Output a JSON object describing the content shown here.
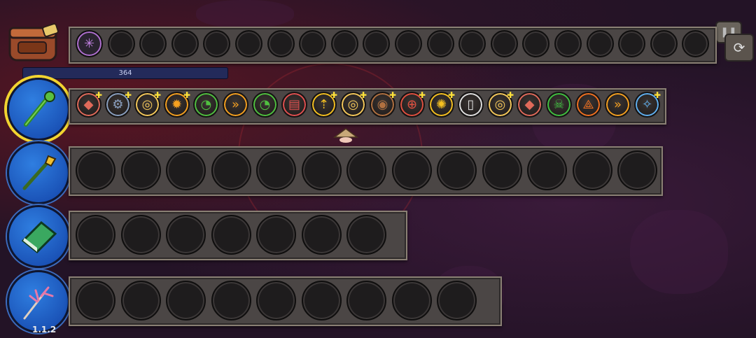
{
  "version": "1.1.2",
  "hp_value": "364",
  "icons": {
    "bag": "backpack-icon",
    "settings": "refresh-icon",
    "pause": "pause-icon"
  },
  "colors": {
    "accent_select": "#f2d430",
    "portrait_blue": "#1e5fc8",
    "bar_gray": "#4b4645"
  },
  "inventory": {
    "total_slots": 20,
    "filled": [
      {
        "icon": "spiderweb-icon"
      }
    ]
  },
  "weapons": [
    {
      "icon": "green-vine-staff-icon",
      "selected": true,
      "upgrades": [
        {
          "icon": "crystal-icon",
          "color": "#e06a5a",
          "plus": true
        },
        {
          "icon": "gear-icon",
          "color": "#8aa0c0",
          "plus": true
        },
        {
          "icon": "target-icon",
          "color": "#f5c85a",
          "plus": true
        },
        {
          "icon": "sun-icon",
          "color": "#f5a020",
          "plus": true
        },
        {
          "icon": "speed-gauge-icon",
          "color": "#50c040",
          "plus": false
        },
        {
          "icon": "double-chevron-icon",
          "color": "#f5a020",
          "plus": false
        },
        {
          "icon": "speed-gauge-icon",
          "color": "#50c040",
          "plus": false
        },
        {
          "icon": "book-icon",
          "color": "#e05050",
          "plus": false
        },
        {
          "icon": "arrow-up-icon",
          "color": "#f5c020",
          "plus": true
        },
        {
          "icon": "target-icon",
          "color": "#f5c85a",
          "plus": true
        },
        {
          "icon": "donut-icon",
          "color": "#b07040",
          "plus": true
        },
        {
          "icon": "bullseye-icon",
          "color": "#e05040",
          "plus": true
        },
        {
          "icon": "explosion-icon",
          "color": "#f5c020",
          "plus": true
        },
        {
          "icon": "mouse-icon",
          "color": "#e0e0e0",
          "plus": false
        },
        {
          "icon": "target-icon",
          "color": "#f5c85a",
          "plus": true
        },
        {
          "icon": "crystal-icon",
          "color": "#e06a5a",
          "plus": false
        },
        {
          "icon": "skull-icon",
          "color": "#40c040",
          "plus": false
        },
        {
          "icon": "triple-arrow-icon",
          "color": "#f07020",
          "plus": false
        },
        {
          "icon": "double-chevron-icon",
          "color": "#f5a020",
          "plus": false
        },
        {
          "icon": "comet-icon",
          "color": "#60b0f0",
          "plus": true
        }
      ]
    },
    {
      "icon": "gold-spear-icon",
      "selected": false,
      "empty_slots": 13
    },
    {
      "icon": "green-book-icon",
      "selected": false,
      "empty_slots": 7
    },
    {
      "icon": "coral-staff-icon",
      "selected": false,
      "empty_slots": 9
    }
  ]
}
